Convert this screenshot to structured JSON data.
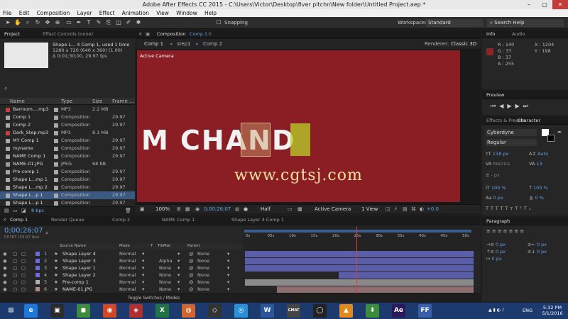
{
  "window": {
    "title": "Adobe After Effects CC 2015 - C:\\Users\\Victor\\Desktop\\fiver pitchn\\New folder\\Untitled Project.aep *"
  },
  "menu": [
    "File",
    "Edit",
    "Composition",
    "Layer",
    "Effect",
    "Animation",
    "View",
    "Window",
    "Help"
  ],
  "toolbar": {
    "snapping_label": "Snapping",
    "workspace_label": "Workspace:",
    "workspace_value": "Standard",
    "search_help": "Search Help"
  },
  "project": {
    "tab_project": "Project",
    "tab_effect_controls": "Effect Controls (none)",
    "selected_name": "Shape L... 4 Comp 1",
    "used": ", used 1 time",
    "size": "1280 x 720  (640 x 360) (1.00)",
    "duration": "Δ 0;01;30;00, 29.97 fps",
    "col_name": "Name",
    "col_type": "Type",
    "col_size": "Size",
    "col_frame": "Frame ...",
    "bpc": "8 bpc",
    "items": [
      {
        "name": "Barroom....mp3",
        "type": "MP3",
        "size": "2.2 MB",
        "frame": "",
        "color": "#c83c3c"
      },
      {
        "name": "Comp 1",
        "type": "Composition",
        "size": "",
        "frame": "29.97",
        "color": "#a8a8a8"
      },
      {
        "name": "Comp 2",
        "type": "Composition",
        "size": "",
        "frame": "29.97",
        "color": "#a8a8a8"
      },
      {
        "name": "Dark_Step.mp3",
        "type": "MP3",
        "size": "8.1 MB",
        "frame": "",
        "color": "#c83c3c"
      },
      {
        "name": "MY Comp 1",
        "type": "Composition",
        "size": "",
        "frame": "29.97",
        "color": "#a8a8a8"
      },
      {
        "name": "myname",
        "type": "Composition",
        "size": "",
        "frame": "29.97",
        "color": "#a8a8a8"
      },
      {
        "name": "NAME Comp 1",
        "type": "Composition",
        "size": "",
        "frame": "29.97",
        "color": "#a8a8a8"
      },
      {
        "name": "NAME-01.JPG",
        "type": "JPEG",
        "size": "68 KB",
        "frame": "",
        "color": "#9c9c9c"
      },
      {
        "name": "Pre-comp 1",
        "type": "Composition",
        "size": "",
        "frame": "29.97",
        "color": "#a8a8a8"
      },
      {
        "name": "Shape L...mp 1",
        "type": "Composition",
        "size": "",
        "frame": "29.97",
        "color": "#a8a8a8"
      },
      {
        "name": "Shape L...mp 2",
        "type": "Composition",
        "size": "",
        "frame": "29.97",
        "color": "#a8a8a8"
      },
      {
        "name": "Shape L...p 1",
        "type": "Composition",
        "size": "",
        "frame": "29.97",
        "color": "#a8a8a8"
      },
      {
        "name": "Shape L...p 1",
        "type": "Composition",
        "size": "",
        "frame": "29.97",
        "color": "#a8a8a8"
      }
    ]
  },
  "composition": {
    "panel_title": "Composition",
    "comp_name": "Comp 1",
    "breadcrumb": [
      "Comp 1",
      "step1",
      "Comp 2"
    ],
    "renderer_label": "Renderer:",
    "renderer_value": "Classic 3D",
    "active_camera": "Active Camera",
    "canvas_text": "M CHAND",
    "watermark": "www.cgtsj.com",
    "zoom": "100%",
    "timecode": "0;00;26;07",
    "resolution": "Half",
    "camera": "Active Camera",
    "views": "1 View",
    "exposure": "+0.0",
    "canvas_color": "#8b1e24"
  },
  "info": {
    "tab_info": "Info",
    "tab_audio": "Audio",
    "r": "R : 140",
    "g": "G : 37",
    "b": "B : 37",
    "a": "A : 255",
    "x": "X : 1204",
    "y": "Y : 198",
    "swatch": "#8c2525"
  },
  "preview": {
    "title": "Preview"
  },
  "character": {
    "tab_effects": "Effects & Presets",
    "tab_character": "Character",
    "font": "Cyberdyne",
    "style": "Regular",
    "size": "118 px",
    "leading": "Auto",
    "kerning": "Metrics",
    "tracking": "13",
    "stroke": "- px",
    "vscale": "100 %",
    "hscale": "100 %",
    "baseline": "0 px",
    "tsume": "0 %"
  },
  "paragraph": {
    "title": "Paragraph",
    "indent_left": "0 px",
    "indent_right": "0 px",
    "space_before": "0 px",
    "space_after": "0 px",
    "first_line": "0 px"
  },
  "timeline": {
    "tabs": [
      "Comp 1",
      "Render Queue",
      "Comp 2",
      "NAME Comp 1",
      "Shape Layer 4 Comp 1"
    ],
    "timecode": "0;00;26;07",
    "frames": "00787 (29.97 fps)",
    "col_source": "Source Name",
    "col_mode": "Mode",
    "col_t": "T",
    "col_trkmat": "TrkMat",
    "col_parent": "Parent",
    "ruler": [
      "0s",
      "05s",
      "10s",
      "15s",
      "20s",
      "25s",
      "30s",
      "35s",
      "40s",
      "45s",
      "50s"
    ],
    "footer": "Toggle Switches / Modes",
    "layers": [
      {
        "num": "1",
        "name": "Shape Layer 4",
        "mode": "Normal",
        "trkmat": "",
        "parent": "None",
        "color": "#6a6ad8",
        "start": 0.0,
        "end": 1.0
      },
      {
        "num": "2",
        "name": "Shape Layer 3",
        "mode": "Normal",
        "trkmat": "Alpha",
        "parent": "None",
        "color": "#6a6ad8",
        "start": 0.0,
        "end": 1.0
      },
      {
        "num": "3",
        "name": "Shape Layer 1",
        "mode": "Normal",
        "trkmat": "None",
        "parent": "None",
        "color": "#6a6ad8",
        "start": 0.0,
        "end": 1.0
      },
      {
        "num": "4",
        "name": "Shape Layer 2",
        "mode": "Normal",
        "trkmat": "None",
        "parent": "None",
        "color": "#6a6ad8",
        "start": 0.41,
        "end": 1.0
      },
      {
        "num": "5",
        "name": "Pre-comp 1",
        "mode": "Normal",
        "trkmat": "None",
        "parent": "None",
        "color": "#b0b0b0",
        "start": 0.0,
        "end": 1.0
      },
      {
        "num": "6",
        "name": "NAME-01.JPG",
        "mode": "Normal",
        "trkmat": "None",
        "parent": "None",
        "color": "#b48a8a",
        "start": 0.14,
        "end": 1.0
      }
    ]
  },
  "taskbar": {
    "language": "ENG",
    "time": "5:32 PM",
    "date": "5/1/2016",
    "apps": [
      "e",
      "▣",
      "◼",
      "◉",
      "◈",
      "X",
      "◍",
      "◇",
      "◎",
      "W",
      "GMAT",
      "◯",
      "▲",
      "⬇",
      "Ae",
      "FF"
    ]
  }
}
